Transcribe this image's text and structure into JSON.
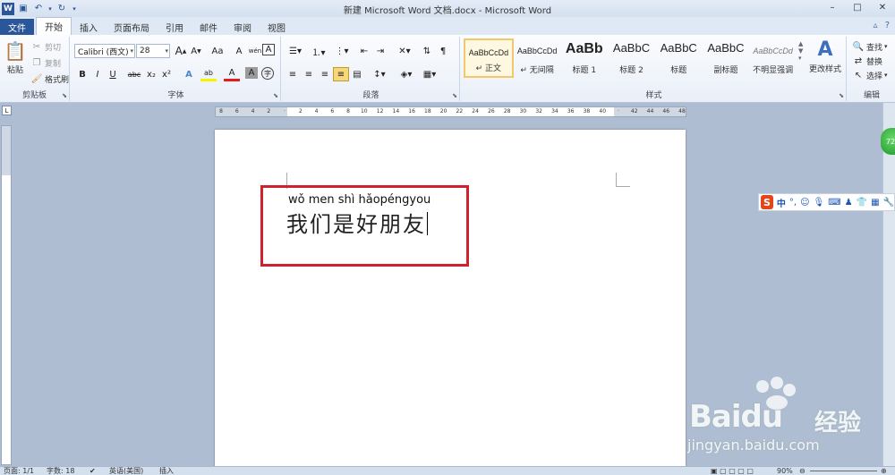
{
  "window": {
    "title": "新建 Microsoft Word 文档.docx - Microsoft Word",
    "minimize": "–",
    "maximize": "□",
    "close": "✕"
  },
  "qat": {
    "logo": "W",
    "save_icon": "save-icon",
    "undo_icon": "undo-icon",
    "redo_icon": "redo-icon"
  },
  "tabs": {
    "file": "文件",
    "items": [
      "开始",
      "插入",
      "页面布局",
      "引用",
      "邮件",
      "审阅",
      "视图"
    ],
    "active": "开始"
  },
  "ribbon": {
    "clipboard": {
      "label": "剪贴板",
      "paste": "粘贴",
      "cut": "剪切",
      "copy": "复制",
      "format_painter": "格式刷"
    },
    "font": {
      "label": "字体",
      "font_name": "Calibri (西文)",
      "font_size": "28",
      "grow": "A",
      "shrink": "A",
      "change_case": "Aa",
      "clear": "A",
      "pinyin": "wén",
      "border_char": "A",
      "bold": "B",
      "italic": "I",
      "underline": "U",
      "strike": "abc",
      "subscript": "x₂",
      "superscript": "x²",
      "text_effect": "A",
      "highlight": "ab",
      "font_color": "A",
      "char_shading": "A",
      "enclose": "字"
    },
    "paragraph": {
      "label": "段落"
    },
    "styles": {
      "label": "样式",
      "items": [
        {
          "sample": "AaBbCcDd",
          "name": "正文",
          "selected": true
        },
        {
          "sample": "AaBbCcDd",
          "name": "无间隔",
          "selected": false
        },
        {
          "sample": "AaBb",
          "name": "标题 1",
          "selected": false
        },
        {
          "sample": "AaBbC",
          "name": "标题 2",
          "selected": false
        },
        {
          "sample": "AaBbC",
          "name": "标题",
          "selected": false
        },
        {
          "sample": "AaBbC",
          "name": "副标题",
          "selected": false
        },
        {
          "sample": "AaBbCcDd",
          "name": "不明显强调",
          "selected": false
        }
      ],
      "change_styles": "更改样式"
    },
    "editing": {
      "label": "编辑",
      "find": "查找",
      "replace": "替换",
      "select": "选择"
    }
  },
  "ruler": {
    "ticks": [
      "8",
      "6",
      "4",
      "2",
      "",
      "2",
      "4",
      "6",
      "8",
      "10",
      "12",
      "14",
      "16",
      "18",
      "20",
      "22",
      "24",
      "26",
      "28",
      "30",
      "32",
      "34",
      "36",
      "38",
      "40",
      "",
      "42",
      "44",
      "46",
      "48"
    ]
  },
  "document": {
    "pinyin": "wǒ men shì hǎopéngyou",
    "text": "我们是好朋友"
  },
  "ime": {
    "logo": "S",
    "mode": "中"
  },
  "side_button": "72",
  "watermark": {
    "brand": "Baidu",
    "jingyan": "经验",
    "url": "jingyan.baidu.com"
  },
  "statusbar": {
    "page": "页面: 1/1",
    "words": "字数: 18",
    "language": "英语(美国)",
    "insert": "插入",
    "zoom": "90%"
  }
}
